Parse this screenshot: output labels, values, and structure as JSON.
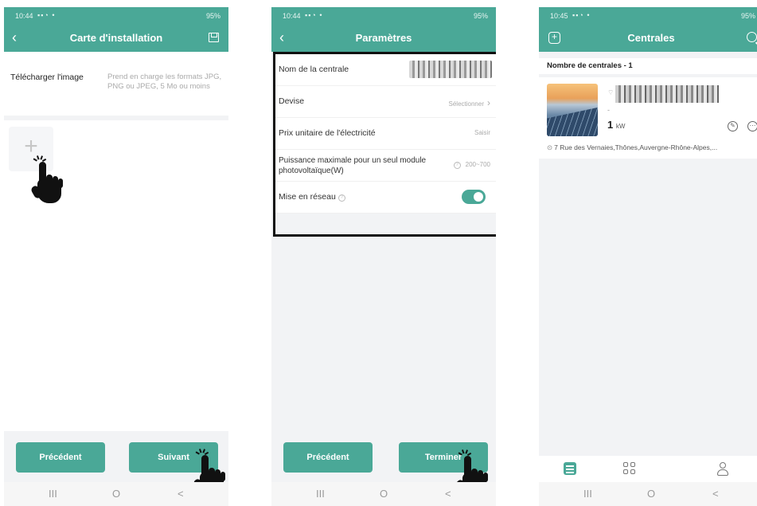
{
  "status": {
    "s1_time": "10:44",
    "s2_time": "10:44",
    "s3_time": "10:45",
    "battery": "95%"
  },
  "screen1": {
    "title": "Carte d'installation",
    "upload_label": "Télécharger l'image",
    "upload_hint": "Prend en charge les formats JPG, PNG ou JPEG, 5 Mo ou moins",
    "upload_plus": "+",
    "prev_button": "Précédent",
    "next_button": "Suivant"
  },
  "screen2": {
    "title": "Paramètres",
    "rows": [
      {
        "label": "Nom de la centrale",
        "value": ""
      },
      {
        "label": "Devise",
        "value": "Sélectionner"
      },
      {
        "label": "Prix unitaire de l'électricité",
        "value": "Saisir"
      },
      {
        "label": "Puissance maximale pour un seul module photovoltaïque(W)",
        "value": "200~700"
      },
      {
        "label": "Mise en réseau",
        "value": ""
      }
    ],
    "grid_enabled": true,
    "prev_button": "Précédent",
    "finish_button": "Terminer"
  },
  "screen3": {
    "title": "Centrales",
    "count_label": "Nombre de centrales - 1",
    "plant": {
      "status_dash": "-",
      "power_value": "1",
      "power_unit": "kW",
      "address": "7 Rue des Vernaies,Thônes,Auvergne-Rhône-Alpes,..."
    }
  },
  "navbar": {
    "recent": "III",
    "home": "O",
    "back": "<"
  },
  "colors": {
    "accent": "#4aa897"
  }
}
